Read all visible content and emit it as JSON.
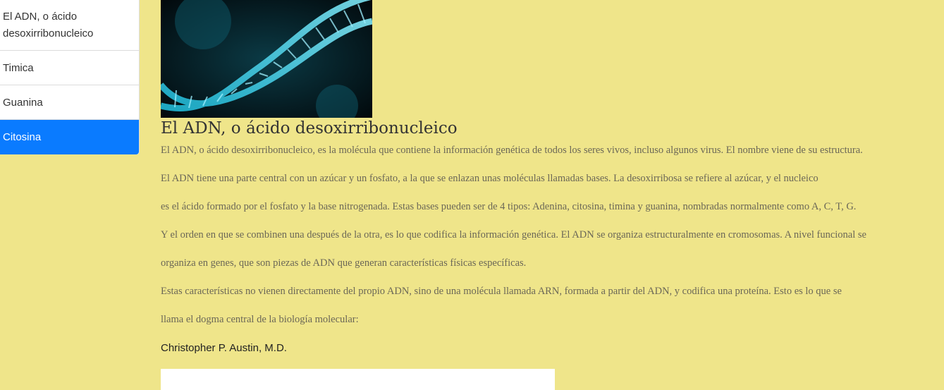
{
  "sidebar": {
    "items": [
      {
        "label": "El ADN, o ácido desoxirribonucleico"
      },
      {
        "label": "Timica"
      },
      {
        "label": "Guanina"
      },
      {
        "label": "Citosina",
        "active": true
      }
    ]
  },
  "main": {
    "hero_image": "dna-helix-image",
    "title": "El ADN, o ácido desoxirribonucleico",
    "paragraphs": [
      "El ADN, o ácido desoxirribonucleico, es la molécula que contiene la información genética de todos los seres vivos, incluso algunos virus. El nombre viene de su estructura.",
      "El ADN tiene una parte central con un azúcar y un fosfato, a la que se enlazan unas moléculas llamadas bases. La desoxirribosa se refiere al azúcar, y el nucleico",
      "es el ácido formado por el fosfato y la base nitrogenada. Estas bases pueden ser de 4 tipos: Adenina, citosina, timina y guanina, nombradas normalmente como A, C, T, G.",
      "Y el orden en que se combinen una después de la otra, es lo que codifica la información genética. El ADN se organiza estructuralmente en cromosomas. A nivel funcional se",
      "organiza en genes, que son piezas de ADN que generan características físicas específicas.",
      "Estas características no vienen directamente del propio ADN, sino de una molécula llamada ARN, formada a partir del ADN, y codifica una proteína. Esto es lo que se",
      "llama el dogma central de la biología molecular:"
    ],
    "author": "Christopher P. Austin, M.D."
  },
  "colors": {
    "background": "#efe58a",
    "active": "#0a7bff",
    "text": "#6b6757"
  }
}
